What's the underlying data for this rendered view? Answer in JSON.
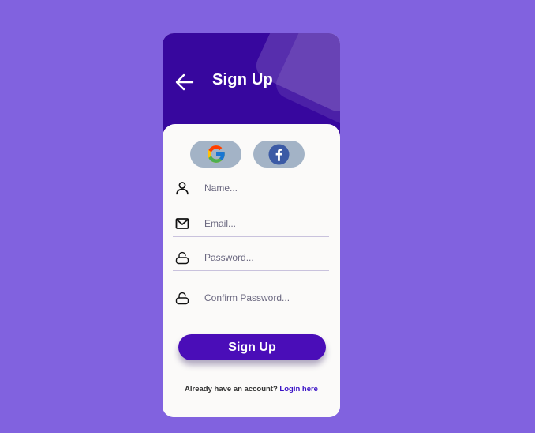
{
  "header": {
    "title": "Sign Up",
    "back_icon": "arrow-left-icon"
  },
  "social": {
    "google_icon": "google-icon",
    "facebook_icon": "facebook-icon"
  },
  "fields": {
    "name": {
      "placeholder": "Name...",
      "value": "",
      "icon": "user-icon"
    },
    "email": {
      "placeholder": "Email...",
      "value": "",
      "icon": "mail-icon"
    },
    "password": {
      "placeholder": "Password...",
      "value": "",
      "icon": "lock-icon"
    },
    "confirm_password": {
      "placeholder": "Confirm Password...",
      "value": "",
      "icon": "lock-icon"
    }
  },
  "signup_button": {
    "label": "Sign Up"
  },
  "footer": {
    "prompt": "Already have an account?",
    "link": "Login here"
  },
  "colors": {
    "background": "#8162df",
    "header": "#37079e",
    "button": "#4a0db8",
    "link": "#3a12c6",
    "social_button": "#a3b3c6"
  }
}
